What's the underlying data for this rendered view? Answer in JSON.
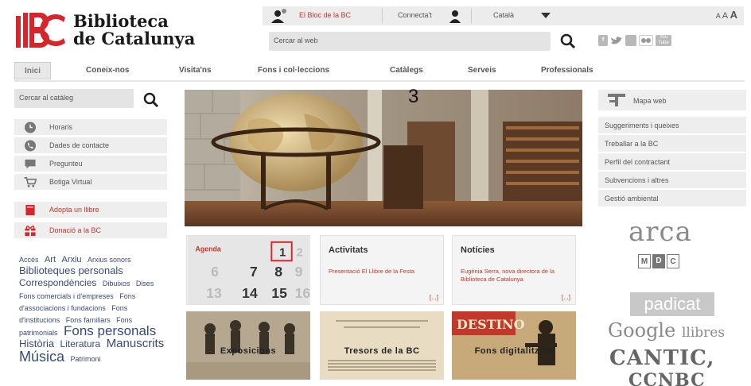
{
  "header": {
    "logo_title_line1": "Biblioteca",
    "logo_title_line2": "de Catalunya",
    "logo_mark": "BC",
    "blog_link": "El Bloc de la BC",
    "connect_label": "Connecta't",
    "language": "Català",
    "text_size": [
      "A",
      "A",
      "A"
    ],
    "search_placeholder": "Cercar al web",
    "social": [
      "f",
      "twitter",
      "rss",
      "flickr",
      "You Tube"
    ]
  },
  "nav": {
    "tabs": [
      "Inici",
      "Coneix-nos",
      "Visita'ns",
      "Fons i col·leccions",
      "Catàlegs",
      "Serveis",
      "Professionals"
    ]
  },
  "left": {
    "search_placeholder": "Cercar al catàleg",
    "items": [
      {
        "label": "Horaris",
        "icon": "clock-icon"
      },
      {
        "label": "Dades de contacte",
        "icon": "phone-icon"
      },
      {
        "label": "Pregunteu",
        "icon": "chat-bubble-icon"
      },
      {
        "label": "Botiga Virtual",
        "icon": "cart-icon"
      },
      {
        "label": "Adopta un llibre",
        "icon": "book-icon"
      },
      {
        "label": "Donació a la BC",
        "icon": "gift-icon"
      }
    ],
    "tags": [
      {
        "text": "Accés",
        "size": 9
      },
      {
        "text": "Art",
        "size": 11
      },
      {
        "text": "Arxiu",
        "size": 11
      },
      {
        "text": "Arxius sonors",
        "size": 9
      },
      {
        "text": "Biblioteques personals",
        "size": 13
      },
      {
        "text": "Correspondències",
        "size": 12
      },
      {
        "text": "Dibuixos",
        "size": 9
      },
      {
        "text": "Dises",
        "size": 9
      },
      {
        "text": "Fons comercials i d'empreses",
        "size": 9
      },
      {
        "text": "Fons d'associacions i fundacions",
        "size": 9
      },
      {
        "text": "Fons d'institucions",
        "size": 9
      },
      {
        "text": "Fons familiars",
        "size": 9
      },
      {
        "text": "Fons patrimonials",
        "size": 9
      },
      {
        "text": "Fons personals",
        "size": 17
      },
      {
        "text": "Història",
        "size": 13
      },
      {
        "text": "Literatura",
        "size": 12
      },
      {
        "text": "Manuscrits",
        "size": 15
      },
      {
        "text": "Música",
        "size": 18
      },
      {
        "text": "Patrimoni",
        "size": 9
      }
    ]
  },
  "hero": {
    "indicator": "3"
  },
  "cards": {
    "agenda": {
      "label": "Agenda",
      "dates": [
        "1",
        "2",
        "6",
        "7",
        "8",
        "9",
        "13",
        "14",
        "15",
        "16"
      ]
    },
    "activitats": {
      "title": "Activitats",
      "text": "Presentació El Llibre de la Festa",
      "more": "[...]"
    },
    "noticies": {
      "title": "Notícies",
      "text": "Eugènia Serra, nova directora de la Biblioteca de Catalunya",
      "more": "[...]"
    }
  },
  "photos": [
    {
      "title": "Exposicions"
    },
    {
      "title": "Tresors de la BC"
    },
    {
      "title": "Fons digitalitzats",
      "caption": "DESTINO"
    }
  ],
  "right": {
    "mapa": "Mapa web",
    "links": [
      "Suggeriments i queixes",
      "Treballar a la BC",
      "Perfil del contractant",
      "Subvencions i altres",
      "Gestió ambiental"
    ],
    "logos": {
      "arca": "arca",
      "mdc": [
        "M",
        "D",
        "C"
      ],
      "padicat": "padicat",
      "google": "Google",
      "google_suffix": "llibres",
      "cantic": "CANTIC,",
      "ccnbc": "CCNBC"
    }
  },
  "colors": {
    "brand_red": "#c0392b",
    "gray_bg": "#eeeeee",
    "text": "#333333"
  }
}
